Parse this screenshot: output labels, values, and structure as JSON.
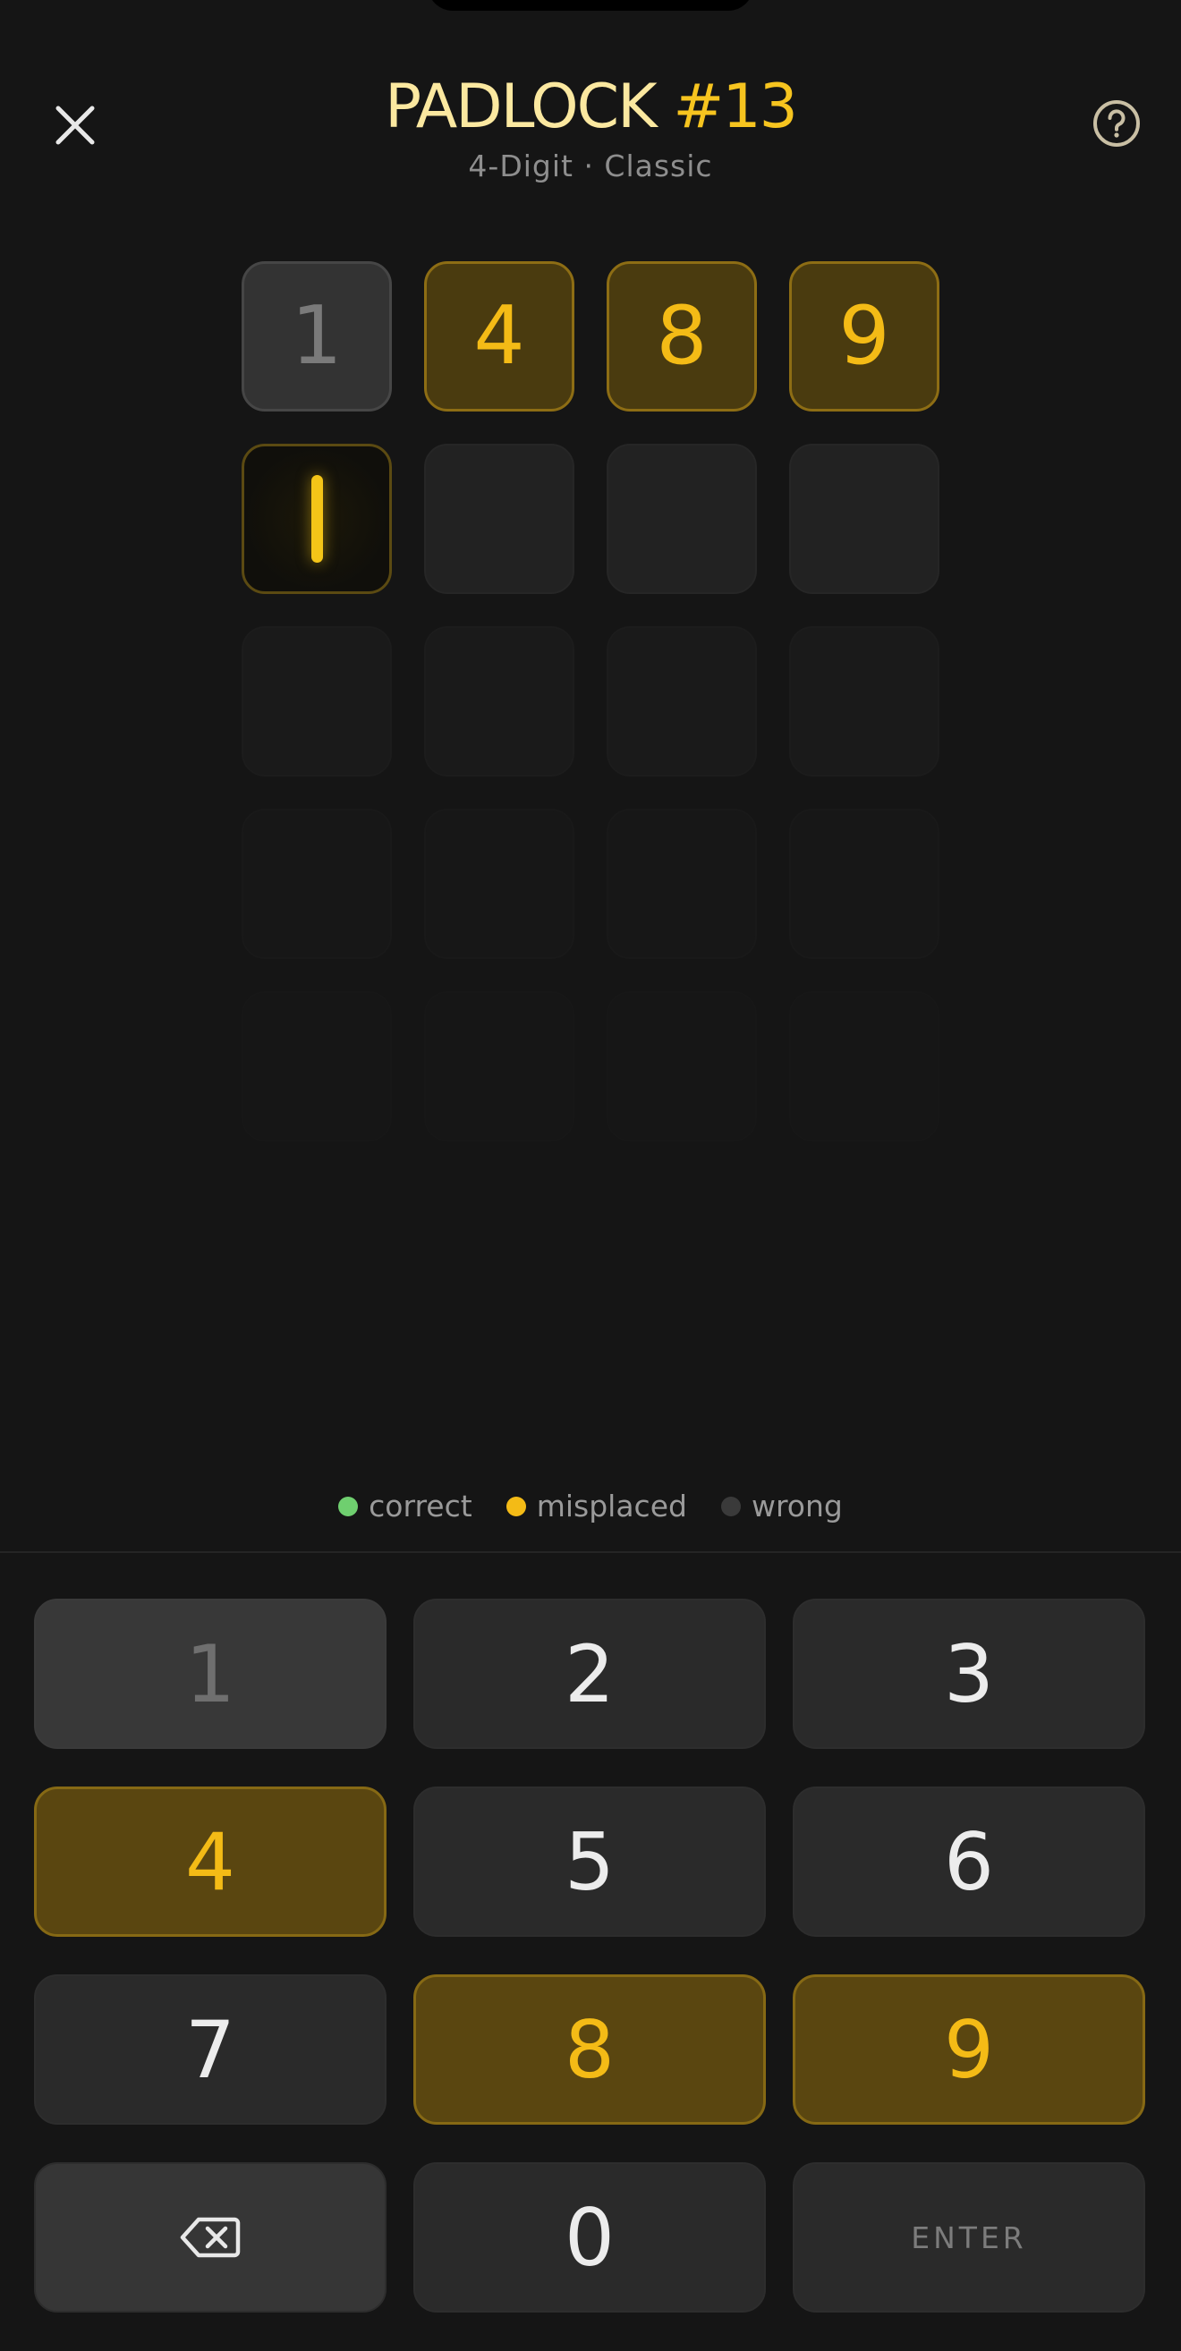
{
  "header": {
    "title_part1": "PADLOCK ",
    "title_part2": "#13",
    "subtitle": "4-Digit · Classic"
  },
  "icons": {
    "close": "close-icon",
    "help": "help-icon",
    "backspace": "backspace-icon"
  },
  "board": {
    "rows": [
      [
        {
          "digit": "1",
          "state": "wrong"
        },
        {
          "digit": "4",
          "state": "misplaced"
        },
        {
          "digit": "8",
          "state": "misplaced"
        },
        {
          "digit": "9",
          "state": "misplaced"
        }
      ],
      [
        {
          "digit": "",
          "state": "active"
        },
        {
          "digit": "",
          "state": "empty"
        },
        {
          "digit": "",
          "state": "empty"
        },
        {
          "digit": "",
          "state": "empty"
        }
      ]
    ]
  },
  "legend": {
    "correct": "correct",
    "misplaced": "misplaced",
    "wrong": "wrong"
  },
  "colors": {
    "correct": "#6fcf6f",
    "misplaced": "#f4bb16",
    "wrong": "#3a3a3a",
    "background": "#151515",
    "title_light": "#fbe8a0",
    "title_accent": "#f6c41f"
  },
  "keypad": {
    "k1": "1",
    "k2": "2",
    "k3": "3",
    "k4": "4",
    "k5": "5",
    "k6": "6",
    "k7": "7",
    "k8": "8",
    "k9": "9",
    "k0": "0",
    "enter": "ENTER"
  }
}
